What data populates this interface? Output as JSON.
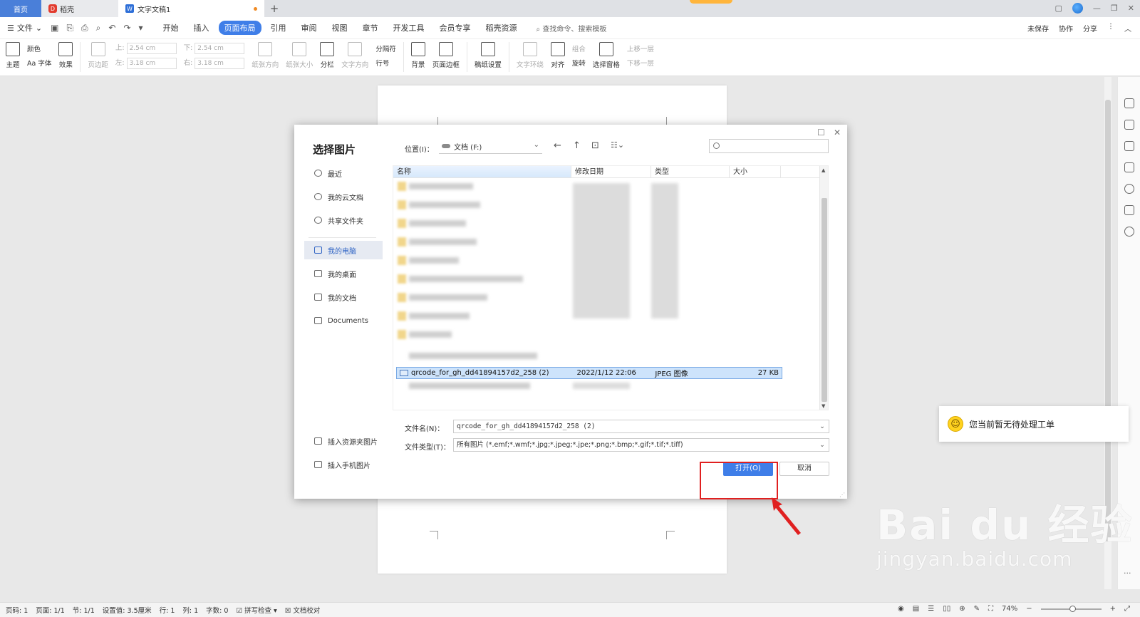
{
  "tabs": {
    "home": "首页",
    "daoke": "稻壳",
    "doc": "文字文稿1",
    "daoke_logo": "D",
    "doc_logo": "W"
  },
  "menu": {
    "file": "文件",
    "items": [
      "开始",
      "插入",
      "页面布局",
      "引用",
      "审阅",
      "视图",
      "章节",
      "开发工具",
      "会员专享",
      "稻壳资源"
    ],
    "active": "页面布局",
    "search": "查找命令、搜索模板",
    "right": [
      "未保存",
      "协作",
      "分享"
    ]
  },
  "ribbon": {
    "theme": "主题",
    "color": "颜色",
    "font": "Aa 字体",
    "effect": "效果",
    "margins": "页边距",
    "top_label": "上:",
    "top_value": "2.54 cm",
    "bottom_label": "下:",
    "bottom_value": "2.54 cm",
    "left_label": "左:",
    "left_value": "3.18 cm",
    "right_label": "右:",
    "right_value": "3.18 cm",
    "orientation": "纸张方向",
    "size": "纸张大小",
    "columns": "分栏",
    "text_dir": "文字方向",
    "separator": "分隔符",
    "line_no": "行号",
    "background": "背景",
    "page_border": "页面边框",
    "paper_setting": "稿纸设置",
    "text_wrap": "文字环绕",
    "align": "对齐",
    "group": "组合",
    "rotate": "旋转",
    "select_pane": "选择窗格",
    "bring_forward": "上移一层",
    "send_backward": "下移一层"
  },
  "dialog": {
    "title": "选择图片",
    "location_label": "位置(I)：",
    "location_value": "文档 (F:)",
    "sidebar": [
      "最近",
      "我的云文档",
      "共享文件夹",
      "我的电脑",
      "我的桌面",
      "我的文档",
      "Documents"
    ],
    "sidebar_selected": "我的电脑",
    "bottom_links": [
      "插入资源夹图片",
      "插入手机图片"
    ],
    "columns": [
      "名称",
      "修改日期",
      "类型",
      "大小"
    ],
    "selected_file": {
      "name": "qrcode_for_gh_dd41894157d2_258 (2)",
      "date": "2022/1/12 22:06",
      "type": "JPEG 图像",
      "size": "27 KB"
    },
    "filename_label": "文件名(N)：",
    "filename_value": "qrcode_for_gh_dd41894157d2_258 (2)",
    "filetype_label": "文件类型(T)：",
    "filetype_value": "所有图片 (*.emf;*.wmf;*.jpg;*.jpeg;*.jpe;*.png;*.bmp;*.gif;*.tif;*.tiff)",
    "open": "打开(O)",
    "cancel": "取消"
  },
  "toast": "您当前暂无待处理工单",
  "watermark": {
    "big": "Bai du 经验",
    "small": "jingyan.baidu.com"
  },
  "status": {
    "page_no": "页码: 1",
    "pages": "页面: 1/1",
    "section": "节: 1/1",
    "setting": "设置值: 3.5厘米",
    "row": "行: 1",
    "col": "列: 1",
    "words": "字数: 0",
    "spell": "拼写检查",
    "proof": "文档校对",
    "zoom": "74%"
  },
  "colors": {
    "accent": "#3f7ee8",
    "highlight": "#e02020"
  }
}
